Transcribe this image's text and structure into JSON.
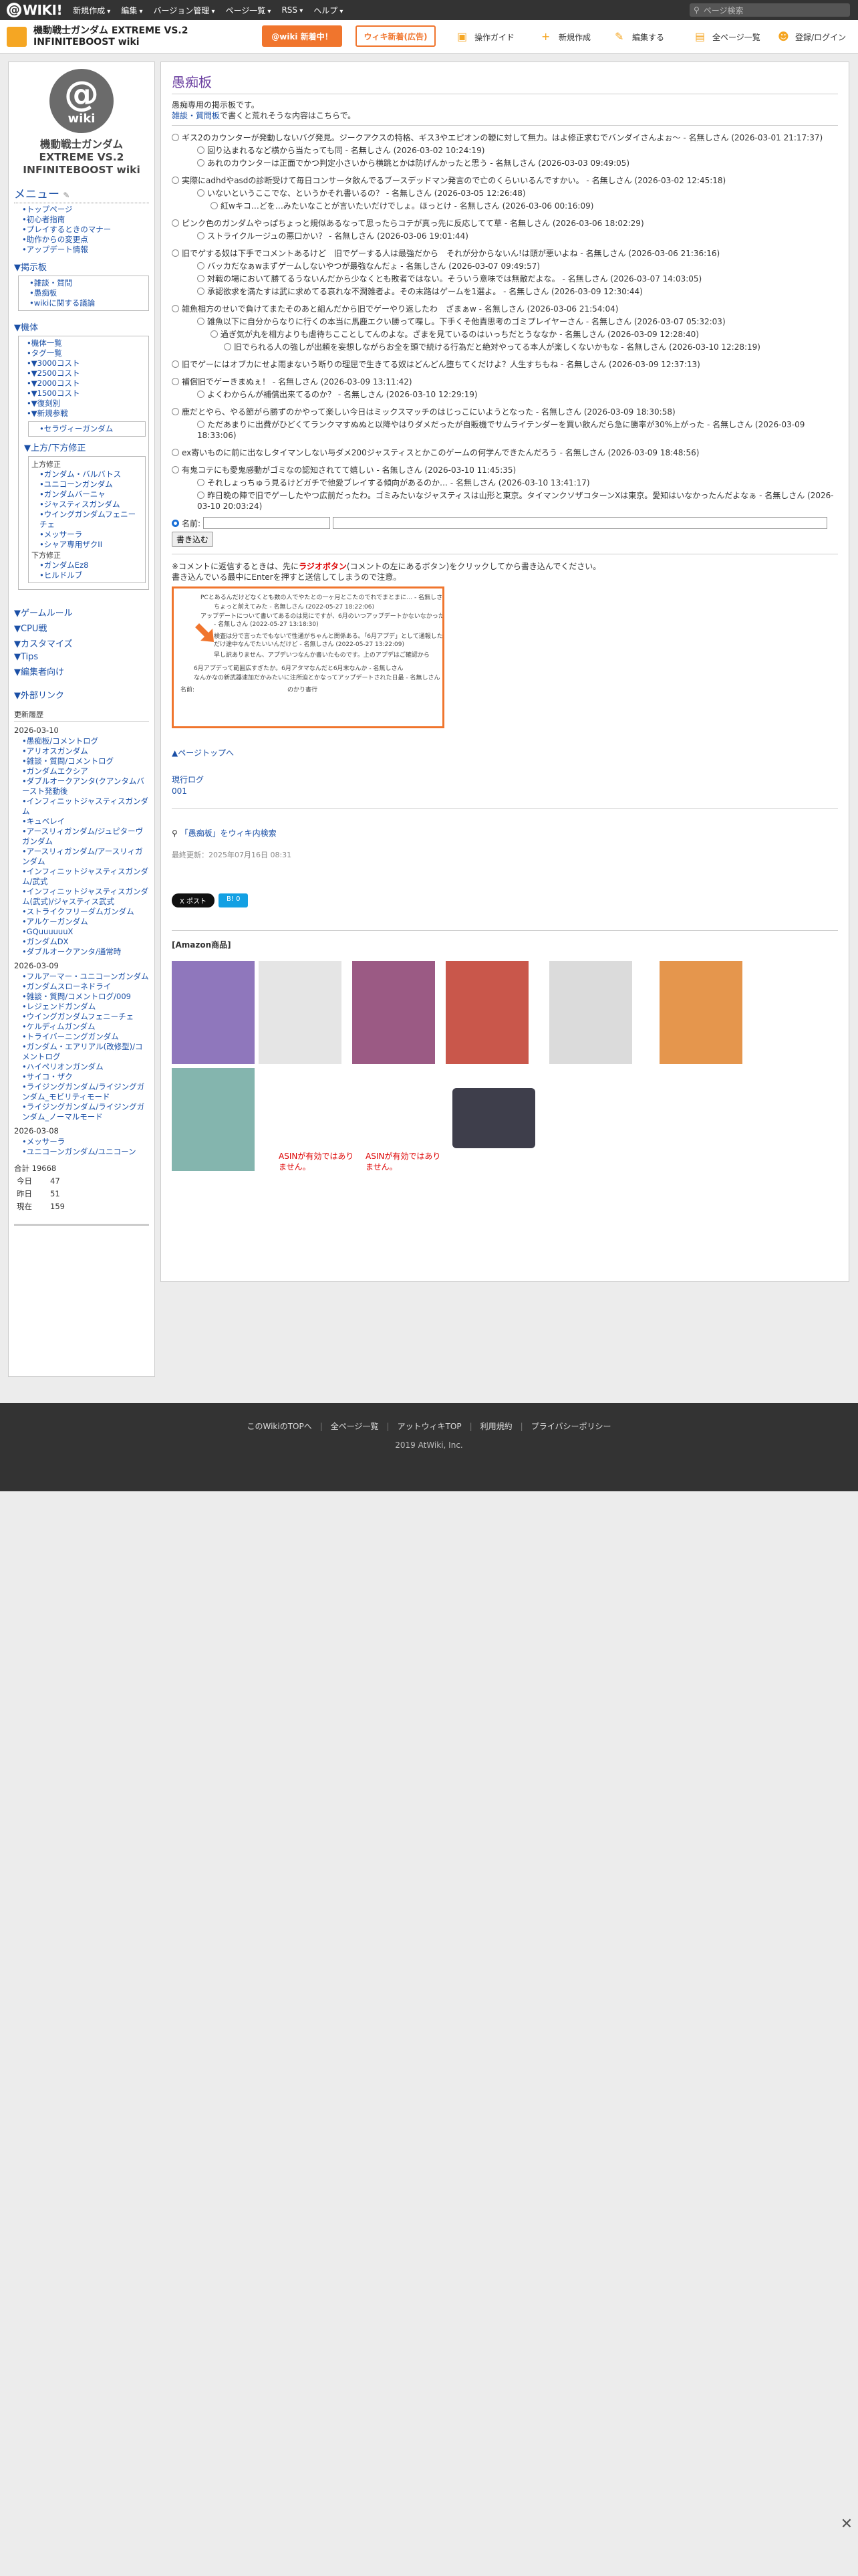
{
  "topbar": {
    "logo": "WIKI!",
    "menus": [
      "新規作成",
      "編集",
      "バージョン管理",
      "ページ一覧",
      "RSS",
      "ヘルプ"
    ],
    "search_placeholder": "ページ検索"
  },
  "header": {
    "site_title_1": "機動戦士ガンダム EXTREME VS.2",
    "site_title_2": "INFINITEBOOST wiki",
    "btn_main": "@wiki 新着中！",
    "btn_sub": "ウィキ新着(広告)",
    "links": [
      "操作ガイド",
      "新規作成",
      "編集する",
      "全ページ一覧",
      "登録/ログイン"
    ]
  },
  "sidebar": {
    "logo_at": "@",
    "logo_text": "wiki",
    "title": "機動戦士ガンダム EXTREME VS.2 INFINITEBOOST wiki",
    "menu_head": "メニュー",
    "menu_items": [
      "トップページ",
      "初心者指南",
      "プレイするときのマナー",
      "助作からの変更点",
      "アップデート情報"
    ],
    "keijiban_head": "▼掲示板",
    "keijiban_items": [
      "雑談・質問",
      "愚痴板",
      "wikiに関する議論"
    ],
    "kitai_head": "▼機体",
    "kitai_items": [
      "機体一覧",
      "タグ一覧",
      "▼3000コスト",
      "▼2500コスト",
      "▼2000コスト",
      "▼1500コスト",
      "▼復刻別",
      "▼新規参戦"
    ],
    "new_items": [
      "セラヴィーガンダム"
    ],
    "ue_head": "▼上方/下方修正",
    "ue_box_title": "上方修正",
    "ue_items": [
      "ガンダム・バルバトス",
      "ユニコーンガンダム",
      "ガンダムバーニャ",
      "ジャスティスガンダム",
      "ウイングガンダムフェニーチェ",
      "メッサーラ",
      "シャア専用ザクII"
    ],
    "shita_title": "下方修正",
    "shita_items": [
      "ガンダムEz8",
      "ヒルドルブ"
    ],
    "other_heads": [
      "▼ゲームルール",
      "▼CPU戦",
      "▼カスタマイズ",
      "▼Tips",
      "▼編集者向け"
    ],
    "ext_head": "▼外部リンク",
    "recent_title": "更新履歴",
    "recent": [
      {
        "date": "2026-03-10",
        "items": [
          "愚痴板/コメントログ",
          "アリオスガンダム",
          "雑談・質問/コメントログ",
          "ガンダムエクシア",
          "ダブルオークアンタ(クアンタムバースト発動後",
          "インフィニットジャスティスガンダム",
          "キュベレイ",
          "アースリィガンダム/ジュピターヴガンダム",
          "アースリィガンダム/アースリィガンダム",
          "インフィニットジャスティスガンダム/武式",
          "インフィニットジャスティスガンダム(武式)/ジャスティス武式",
          "ストライクフリーダムガンダム",
          "アルケーガンダム",
          "GQuuuuuuX",
          "ガンダムDX",
          "ダブルオークアンタ/通常時"
        ]
      },
      {
        "date": "2026-03-09",
        "items": [
          "フルアーマー・ユニコーンガンダム",
          "ガンダムスローネドライ",
          "雑談・質問/コメントログ/009",
          "レジェンドガンダム",
          "ウイングガンダムフェニーチェ",
          "ケルディムガンダム",
          "トライバーニングガンダム",
          "ガンダム・エアリアル(改修型)/コメントログ",
          "ハイペリオンガンダム",
          "サイコ・ザク",
          "ライジングガンダム/ライジングガンダム_モビリティモード",
          "ライジングガンダム/ライジングガンダム_ノーマルモード"
        ]
      },
      {
        "date": "2026-03-08",
        "items": [
          "メッサーラ",
          "ユニコーンガンダム/ユニコーン"
        ]
      }
    ],
    "counts": {
      "total_label": "合計",
      "total": "19668",
      "today_label": "今日",
      "today": "47",
      "yesterday_label": "昨日",
      "yesterday": "51",
      "now_label": "現在",
      "now": "159"
    }
  },
  "main": {
    "title": "愚痴板",
    "intro_1": "愚痴専用の掲示板です。",
    "intro_2_link": "雑談・質問板",
    "intro_2": "で書くと荒れそうな内容はこちらで。",
    "comments": [
      {
        "lvl": 1,
        "top": true,
        "text": "ギス2のカウンターが発動しないバグ発見。ジークアクスの特格、ギス3やエピオンの鞭に対して無力。はよ修正求むでバンダイさんよぉ～ - 名無しさん (2026-03-01 21:17:37)"
      },
      {
        "lvl": 2,
        "text": "回り込まれるなど横から当たっても同 - 名無しさん (2026-03-02 10:24:19)"
      },
      {
        "lvl": 2,
        "text": "あれのカウンターは正面でかつ判定小さいから横跳とかは防げんかったと思う - 名無しさん (2026-03-03 09:49:05)"
      },
      {
        "lvl": 1,
        "top": true,
        "text": "実際にadhdやasdの診断受けて毎日コンサータ飲んでるブースデッドマン発言ので亡のくらいいるんですかい。 - 名無しさん (2026-03-02 12:45:18)"
      },
      {
        "lvl": 2,
        "text": "いないというここでな、というかそれ書いるの？ - 名無しさん (2026-03-05 12:26:48)"
      },
      {
        "lvl": 3,
        "text": "紅wキコ…どを…みたいなことが言いたいだけでしょ。ほっとけ - 名無しさん (2026-03-06 00:16:09)"
      },
      {
        "lvl": 1,
        "top": true,
        "text": "ピンク色のガンダムやっぱちょっと規似あるなって思ったらコテが真っ先に反応してて草 - 名無しさん (2026-03-06 18:02:29)"
      },
      {
        "lvl": 2,
        "text": "ストライクルージュの悪口かい？ - 名無しさん (2026-03-06 19:01:44)"
      },
      {
        "lvl": 1,
        "top": true,
        "text": "旧でゲする奴は下手でコメントあるけど　旧でゲーする人は最強だから　それが分からないん!は頭が悪いよね - 名無しさん (2026-03-06 21:36:16)"
      },
      {
        "lvl": 2,
        "text": "バッカだなぁwまずゲームしないやつが最強なんだょ - 名無しさん (2026-03-07 09:49:57)"
      },
      {
        "lvl": 2,
        "text": "対戦の場において勝てるうないんだから少なくとも敗者ではない。そういう意味では無敵だよな。 - 名無しさん (2026-03-07 14:03:05)"
      },
      {
        "lvl": 2,
        "text": "承認欲求を満たすは武に求めてる哀れな不潤雑者よ。その末路はゲームを1選よ。 - 名無しさん (2026-03-09 12:30:44)"
      },
      {
        "lvl": 1,
        "top": true,
        "text": "雑魚相方のせいで負けてまたそのあと組んだから旧でゲーやり返したわ　ざまぁw - 名無しさん (2026-03-06 21:54:04)"
      },
      {
        "lvl": 2,
        "text": "雑魚以下に自分からなりに行くの本当に馬鹿エクい勝って喋し。下手くそ他責思考のゴミプレイヤーさん - 名無しさん (2026-03-07 05:32:03)"
      },
      {
        "lvl": 3,
        "text": "過ぎ気が丸を相方よりも虐待ちこことしてんのよな。ざまを見ているのはいっちだとうななか - 名無しさん (2026-03-09 12:28:40)"
      },
      {
        "lvl": 4,
        "text": "旧でられる人の強しが出頼を妄想しながらお全を頭で続ける行為だと絶対やってる本人が楽しくないかもな - 名無しさん (2026-03-10 12:28:19)"
      },
      {
        "lvl": 1,
        "top": true,
        "text": "旧でゲーにはオブカにせよ雨まないう断りの理屈で生きてる奴はどんどん堕ちてくだけよ？人生すちもね - 名無しさん (2026-03-09 12:37:13)"
      },
      {
        "lvl": 1,
        "top": true,
        "text": "補償旧でゲーきまぬぇ！ - 名無しさん (2026-03-09 13:11:42)"
      },
      {
        "lvl": 2,
        "text": "よくわからんが補償出来てるのか？ - 名無しさん (2026-03-10 12:29:19)"
      },
      {
        "lvl": 1,
        "top": true,
        "text": "鹿だとやら、やる節がら勝ずのかやって楽しい今日はミックスマッチのはじっこにいようとなった - 名無しさん (2026-03-09 18:30:58)"
      },
      {
        "lvl": 2,
        "text": "ただあまりに出費がひどくてランクマすぬぬと以降やはりダメだったが自販機でサムライテンダーを買い飲んだら急に勝率が30%上がった - 名無しさん (2026-03-09 18:33:06)"
      },
      {
        "lvl": 1,
        "top": true,
        "text": "ex寄いものに前に出なしタイマンしない与ダメ200ジャスティスとかこのゲームの何学んできたんだろう - 名無しさん (2026-03-09 18:48:56)"
      },
      {
        "lvl": 1,
        "top": true,
        "text": "有鬼コテにも愛鬼感動がゴミなの認知されてて嬉しい - 名無しさん (2026-03-10 11:45:35)"
      },
      {
        "lvl": 2,
        "text": "それしょっちゅう見るけどガチで他愛ブレイする傾向があるのか… - 名無しさん (2026-03-10 13:41:17)"
      },
      {
        "lvl": 2,
        "text": "昨日晩の陣で旧でゲーしたやつ広前だったわ。ゴミみたいなジャスティスは山形と東京。タイマンクソザコターンXは東京。愛知はいなかったんだよなぁ - 名無しさん (2026-03-10 20:03:24)"
      }
    ],
    "name_label": "名前:",
    "submit_label": "書き込む",
    "note_1a": "※コメントに返信するときは、先に",
    "note_1b": "ラジオボタン",
    "note_1c": "(コメントの左にあるボタン)をクリックしてから書き込んでください。",
    "note_2": "書き込んでいる最中にEnterを押すと送信してしまうので注意。",
    "guide": {
      "lines": [
        "PCとあるんだけどなくとも数の人でやたとの一ヶ月とこたのでれでまとまに… - 名無しさん",
        "ちょっと前えてみた - 名無しさん (2022-05-27 18:22:06)",
        "アップデートについて書いてあるのは見にですが、6月のいつアップデートかないなかったですか",
        "- 名無しさん (2022-05-27 13:18:30)",
        "検査は分で言ったでもないで性通がちゃんと関係ある。「6月アプデ」として通報したが",
        "だけ途中なんでたいいんだけど - 名無しさん (2022-05-27 13:22:09)",
        "早し訳ありません、アプデいつなんか書いたものです。上のアプデはご確認から",
        "6月アプデって範囲広すぎたか。6月アタマなんだと6月末なんか - 名無しさん",
        "なんかなの新武器速加だかみたいに注所迫とかなってアップデートされた日最 - 名無しさん",
        "名前:",
        "のかり書行"
      ]
    },
    "pagetop": "▲ページトップへ",
    "history_head": "現行ログ",
    "history_items": [
      "001"
    ],
    "wiki_search": "「愚痴板」をウィキ内検索",
    "updated": "最終更新：2025年07月16日 08:31",
    "share_x": "X ポスト",
    "share_b": "B! 0",
    "amazon_head": "[Amazon商品]",
    "asin_text": "ASINが有効ではありません。",
    "products": [
      "ps4-game-box",
      "white-gundam-figure",
      "purple-gundam-figure",
      "red-gundam-figure",
      "silver-gundam-figure",
      "orange-food-items",
      "switch-game-box",
      "roblox-card"
    ]
  },
  "footer": {
    "links": [
      "このWikiのTOPへ",
      "全ページ一覧",
      "アットウィキTOP",
      "利用規約",
      "プライバシーポリシー"
    ],
    "copy": "2019 AtWiki, Inc."
  },
  "colors": {
    "accent": "#f0752d",
    "link": "#1a4fa6",
    "title": "#6b3fa0",
    "footer_bg": "#333333"
  }
}
